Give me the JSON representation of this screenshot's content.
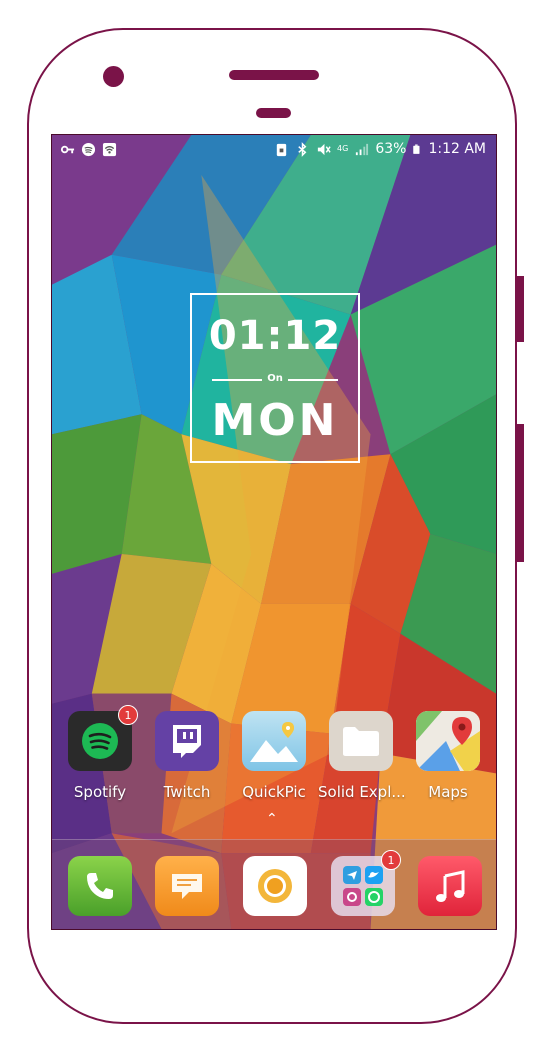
{
  "status_bar": {
    "network": "4G",
    "battery": "63%",
    "time": "1:12 AM"
  },
  "clock_widget": {
    "time": "01:12",
    "connector": "On",
    "day": "MON"
  },
  "apps": [
    {
      "label": "Spotify",
      "badge": "1"
    },
    {
      "label": "Twitch"
    },
    {
      "label": "QuickPic"
    },
    {
      "label": "Solid Expl..."
    },
    {
      "label": "Maps"
    }
  ],
  "dock": [
    {
      "name": "Phone"
    },
    {
      "name": "Messages"
    },
    {
      "name": "Chrome"
    },
    {
      "name": "Social folder",
      "badge": "1"
    },
    {
      "name": "Music"
    }
  ],
  "colors": {
    "frame": "#7a1348",
    "spotify": "#1db954",
    "twitch": "#6441a5",
    "badge": "#e23b3b"
  }
}
